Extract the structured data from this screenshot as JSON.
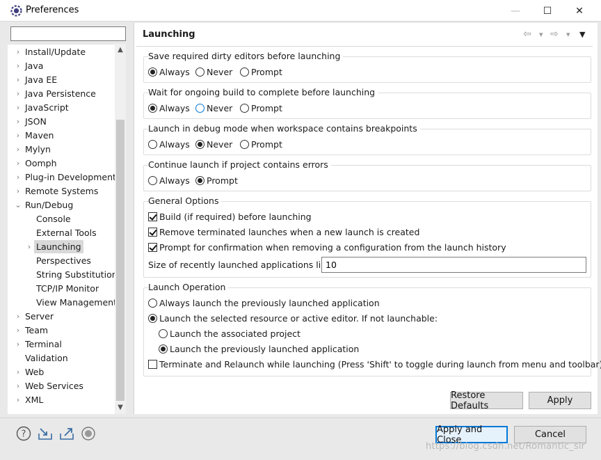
{
  "window": {
    "title": "Preferences",
    "minimize": "—",
    "maximize": "☐",
    "close": "✕"
  },
  "filter": {
    "value": "",
    "placeholder": ""
  },
  "tree": {
    "items": [
      {
        "label": "Install/Update",
        "chevron": "›"
      },
      {
        "label": "Java",
        "chevron": "›"
      },
      {
        "label": "Java EE",
        "chevron": "›"
      },
      {
        "label": "Java Persistence",
        "chevron": "›"
      },
      {
        "label": "JavaScript",
        "chevron": "›"
      },
      {
        "label": "JSON",
        "chevron": "›"
      },
      {
        "label": "Maven",
        "chevron": "›"
      },
      {
        "label": "Mylyn",
        "chevron": "›"
      },
      {
        "label": "Oomph",
        "chevron": "›"
      },
      {
        "label": "Plug-in Development",
        "chevron": "›"
      },
      {
        "label": "Remote Systems",
        "chevron": "›"
      },
      {
        "label": "Run/Debug",
        "chevron": "⌄"
      },
      {
        "label": "Console",
        "chevron": ""
      },
      {
        "label": "External Tools",
        "chevron": ""
      },
      {
        "label": "Launching",
        "chevron": "›"
      },
      {
        "label": "Perspectives",
        "chevron": ""
      },
      {
        "label": "String Substitution",
        "chevron": ""
      },
      {
        "label": "TCP/IP Monitor",
        "chevron": ""
      },
      {
        "label": "View Management",
        "chevron": ""
      },
      {
        "label": "Server",
        "chevron": "›"
      },
      {
        "label": "Team",
        "chevron": "›"
      },
      {
        "label": "Terminal",
        "chevron": "›"
      },
      {
        "label": "Validation",
        "chevron": ""
      },
      {
        "label": "Web",
        "chevron": "›"
      },
      {
        "label": "Web Services",
        "chevron": "›"
      },
      {
        "label": "XML",
        "chevron": "›"
      }
    ],
    "selected": "Launching",
    "scroll_up": "▲",
    "scroll_down": "▼"
  },
  "page": {
    "title": "Launching",
    "nav_back": "⇦",
    "nav_forward": "⇨",
    "dropdown": "▾",
    "menu": "▼"
  },
  "save_dirty": {
    "label": "Save required dirty editors before launching",
    "options": [
      "Always",
      "Never",
      "Prompt"
    ],
    "selected": "Always"
  },
  "wait_build": {
    "label": "Wait for ongoing build to complete before launching",
    "options": [
      "Always",
      "Never",
      "Prompt"
    ],
    "selected": "Always"
  },
  "debug_mode": {
    "label": "Launch in debug mode when workspace contains breakpoints",
    "options": [
      "Always",
      "Never",
      "Prompt"
    ],
    "selected": "Never"
  },
  "continue_errors": {
    "label": "Continue launch if project contains errors",
    "options": [
      "Always",
      "Prompt"
    ],
    "selected": "Prompt"
  },
  "general": {
    "label": "General Options",
    "build": {
      "label": "Build (if required) before launching",
      "checked": true
    },
    "remove_terminated": {
      "label": "Remove terminated launches when a new launch is created",
      "checked": true
    },
    "prompt_confirm": {
      "label": "Prompt for confirmation when removing a configuration from the launch history",
      "checked": true
    },
    "list_size_label": "Size of recently launched applications list:",
    "list_size_value": "10"
  },
  "launch_operation": {
    "label": "Launch Operation",
    "always_previous": "Always launch the previously launched application",
    "launch_selected": "Launch the selected resource or active editor. If not launchable:",
    "launch_associated": "Launch the associated project",
    "launch_previous": "Launch the previously launched application",
    "terminate_relaunch": "Terminate and Relaunch while launching (Press 'Shift' to toggle during launch from menu and toolbar)"
  },
  "buttons": {
    "restore_defaults": "Restore Defaults",
    "apply": "Apply",
    "apply_close": "Apply and Close",
    "cancel": "Cancel"
  },
  "bottom_icons": [
    "help-icon",
    "import-icon",
    "export-icon",
    "record-icon"
  ],
  "watermark": "https://blog.csdn.net/Romantic_sir"
}
